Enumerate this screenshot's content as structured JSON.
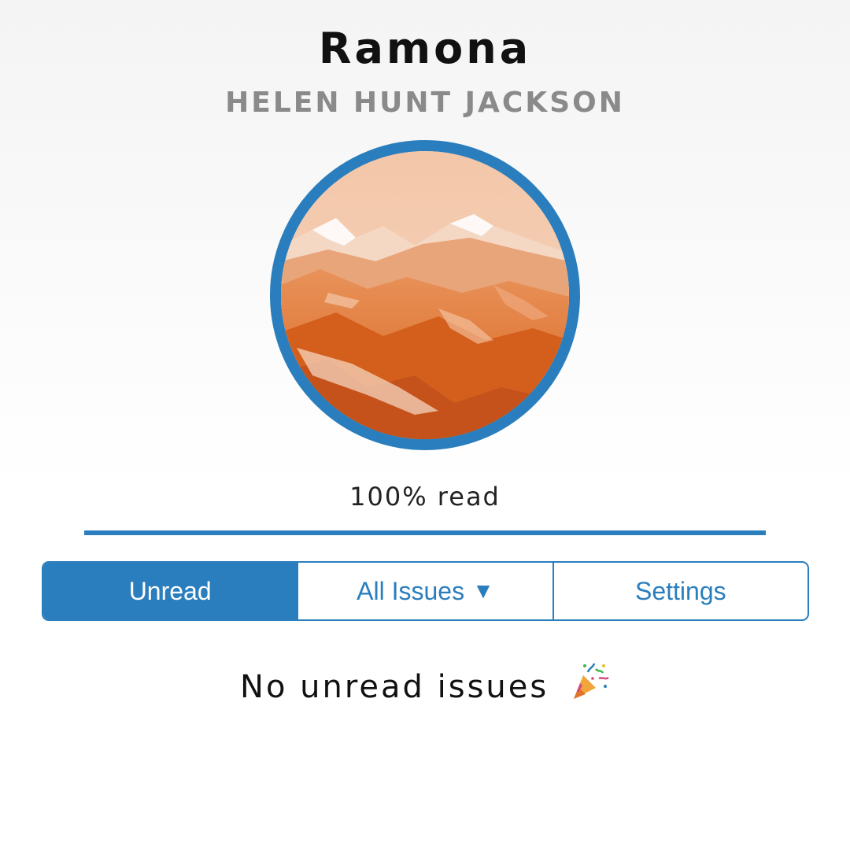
{
  "book": {
    "title": "Ramona",
    "author": "HELEN HUNT JACKSON",
    "cover_icon": "mountain-landscape-image"
  },
  "progress": {
    "label": "100% read",
    "fraction": 1.0
  },
  "tabs": {
    "unread": "Unread",
    "all_issues": "All Issues",
    "all_issues_caret": "▼",
    "settings": "Settings",
    "selected": "Unread"
  },
  "empty_state": {
    "message": "No unread issues",
    "icon": "party-popper-icon"
  },
  "colors": {
    "accent": "#2a7ebd",
    "cover_tint": "#e07a2e"
  }
}
